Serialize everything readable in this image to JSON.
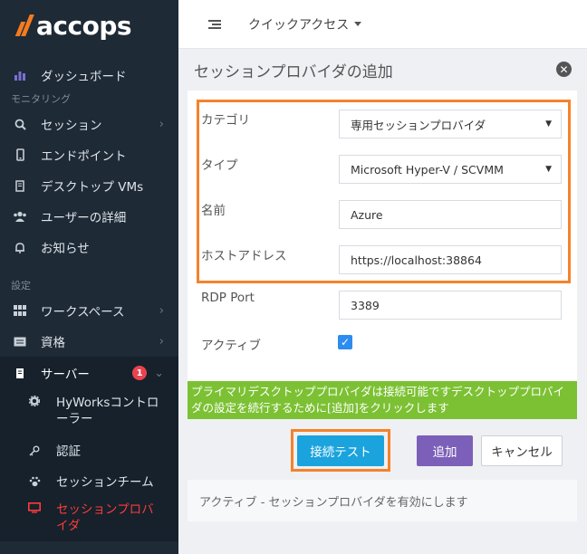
{
  "brand": {
    "name": "accops",
    "accent": "#f47b20"
  },
  "sidebar": {
    "items_top": [
      {
        "label": "ダッシュボード",
        "icon": "bar-chart-icon"
      }
    ],
    "section_monitoring": "モニタリング",
    "items_monitoring": [
      {
        "label": "セッション",
        "icon": "search-icon"
      },
      {
        "label": "エンドポイント",
        "icon": "mobile-icon"
      },
      {
        "label": "デスクトップ VMs",
        "icon": "server-icon"
      },
      {
        "label": "ユーザーの詳細",
        "icon": "users-icon"
      },
      {
        "label": "お知らせ",
        "icon": "bell-icon"
      }
    ],
    "section_settings": "設定",
    "items_settings": [
      {
        "label": "ワークスペース",
        "icon": "grid-icon"
      },
      {
        "label": "資格",
        "icon": "id-card-icon"
      },
      {
        "label": "サーバー",
        "icon": "server-icon",
        "badge": "1"
      }
    ],
    "sub_items": [
      {
        "label": "HyWorksコントローラー",
        "icon": "gear-icon"
      },
      {
        "label": "認証",
        "icon": "key-icon"
      },
      {
        "label": "セッションチーム",
        "icon": "paw-icon"
      },
      {
        "label": "セッションプロバイダ",
        "icon": "monitor-icon",
        "current": true
      }
    ]
  },
  "topbar": {
    "quick_access": "クイックアクセス"
  },
  "panel": {
    "title": "セッションプロバイダの追加",
    "fields": {
      "category": {
        "label": "カテゴリ",
        "value": "専用セッションプロバイダ"
      },
      "type": {
        "label": "タイプ",
        "value": "Microsoft Hyper-V / SCVMM"
      },
      "name": {
        "label": "名前",
        "value": "Azure"
      },
      "host": {
        "label": "ホストアドレス",
        "value": "https://localhost:38864"
      },
      "rdp_port": {
        "label": "RDP Port",
        "value": "3389"
      },
      "active": {
        "label": "アクティブ",
        "checked": true
      }
    },
    "note": "プライマリデスクトッププロバイダは接続可能ですデスクトッププロバイダの設定を続行するために[追加]をクリックします",
    "buttons": {
      "test": "接続テスト",
      "add": "追加",
      "cancel": "キャンセル"
    },
    "help": "アクティブ - セッションプロバイダを有効にします"
  }
}
